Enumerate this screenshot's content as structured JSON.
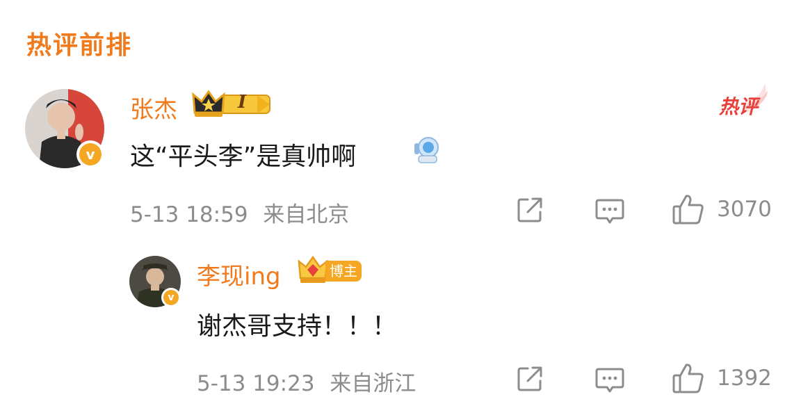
{
  "section": {
    "title": "热评前排"
  },
  "comments": [
    {
      "username": "张杰",
      "level_label": "I",
      "hot_label": "热评",
      "text": "这“平头李”是真帅啊",
      "emoji_name": "astronaut-emoji",
      "date": "5-13 18:59",
      "location": "来自北京",
      "likes": "3070"
    }
  ],
  "reply": {
    "username": "李现ing",
    "badge_label": "博主",
    "text": "谢杰哥支持！！！",
    "date": "5-13 19:23",
    "location": "来自浙江",
    "likes": "1392"
  },
  "colors": {
    "accent": "#f07a1c",
    "verified": "#f5a623",
    "meta": "#8c8c8c",
    "hot": "#e8413a"
  },
  "icons": [
    "share-icon",
    "comment-icon",
    "like-icon",
    "crown-icon",
    "verified-icon"
  ]
}
